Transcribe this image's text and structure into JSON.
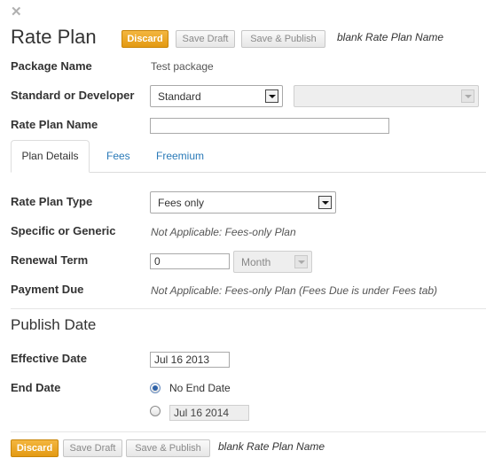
{
  "header": {
    "close_glyph": "✕",
    "title": "Rate Plan",
    "discard_label": "Discard",
    "save_draft_label": "Save Draft",
    "save_publish_label": "Save & Publish",
    "status_note": "blank Rate Plan Name"
  },
  "form": {
    "package_name_label": "Package Name",
    "package_name_value": "Test package",
    "standard_label": "Standard or Developer",
    "standard_value": "Standard",
    "developer_value": "",
    "rate_plan_name_label": "Rate Plan Name",
    "rate_plan_name_value": ""
  },
  "tabs": [
    {
      "label": "Plan Details",
      "active": true
    },
    {
      "label": "Fees",
      "active": false
    },
    {
      "label": "Freemium",
      "active": false
    }
  ],
  "plan_details": {
    "rate_plan_type_label": "Rate Plan Type",
    "rate_plan_type_value": "Fees only",
    "specific_label": "Specific or Generic",
    "specific_value": "Not Applicable: Fees-only Plan",
    "renewal_label": "Renewal Term",
    "renewal_value": "0",
    "renewal_unit": "Month",
    "payment_due_label": "Payment Due",
    "payment_due_value": "Not Applicable: Fees-only Plan (Fees Due is under Fees tab)"
  },
  "publish": {
    "section_title": "Publish Date",
    "effective_label": "Effective Date",
    "effective_value": "Jul 16 2013",
    "end_label": "End Date",
    "no_end_label": "No End Date",
    "end_date_value": "Jul 16 2014",
    "no_end_selected": true
  },
  "footer": {
    "discard_label": "Discard",
    "save_draft_label": "Save Draft",
    "save_publish_label": "Save & Publish",
    "status_note": "blank Rate Plan Name"
  },
  "colors": {
    "accent_orange": "#e39a13",
    "link_blue": "#2a7ab8",
    "radio_blue": "#2f62a8"
  }
}
